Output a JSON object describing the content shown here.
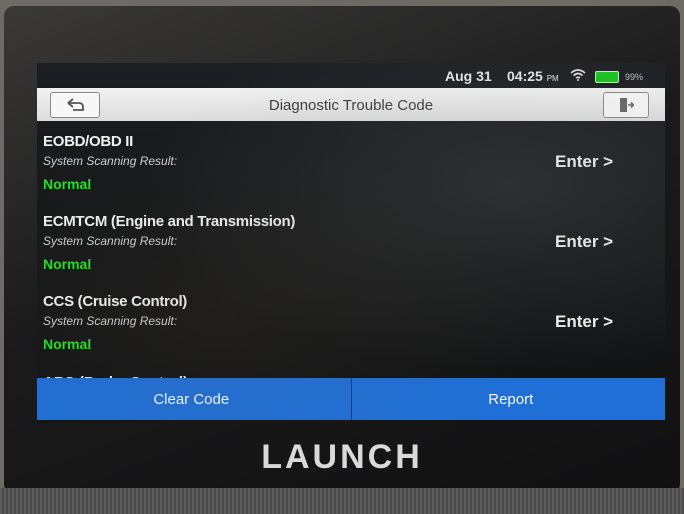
{
  "status_bar": {
    "date": "Aug 31",
    "time": "04:25",
    "ampm": "PM",
    "battery": "99%"
  },
  "header": {
    "title": "Diagnostic Trouble Code"
  },
  "systems": [
    {
      "name": "EOBD/OBD II",
      "label": "System Scanning Result:",
      "status": "Normal",
      "action": "Enter >"
    },
    {
      "name": "ECMTCM (Engine and Transmission)",
      "label": "System Scanning Result:",
      "status": "Normal",
      "action": "Enter >"
    },
    {
      "name": "CCS (Cruise Control)",
      "label": "System Scanning Result:",
      "status": "Normal",
      "action": "Enter >"
    }
  ],
  "partial_item": "ABS (Brake Control)",
  "footer": {
    "clear_label": "Clear Code",
    "report_label": "Report"
  },
  "device": {
    "brand": "LAUNCH"
  },
  "colors": {
    "accent_blue": "#1f6fd6",
    "status_green": "#22e02a"
  },
  "icons": {
    "back": "back-arrow-icon",
    "exit": "exit-icon",
    "wifi": "wifi-icon",
    "battery": "battery-icon"
  }
}
